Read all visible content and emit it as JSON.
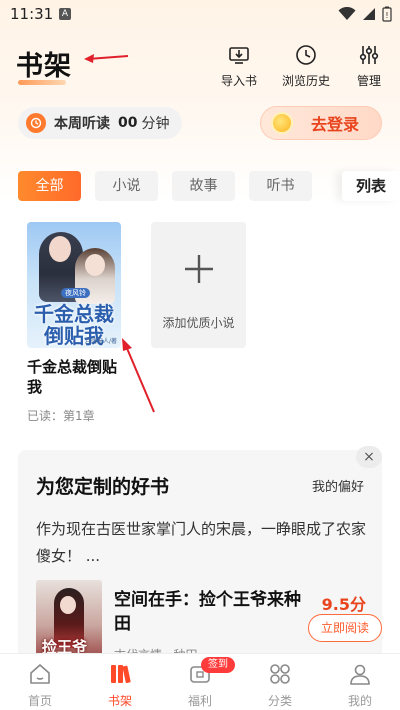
{
  "status_bar": {
    "time": "11:31",
    "notification": "A"
  },
  "header": {
    "title": "书架",
    "actions": [
      {
        "icon": "import-book-icon",
        "label": "导入书"
      },
      {
        "icon": "history-clock-icon",
        "label": "浏览历史"
      },
      {
        "icon": "manage-sliders-icon",
        "label": "管理"
      }
    ]
  },
  "listen": {
    "label": "本周听读",
    "value": "00",
    "unit": "分钟"
  },
  "login": {
    "label": "去登录"
  },
  "filter_tabs": [
    "全部",
    "小说",
    "故事",
    "听书"
  ],
  "list_toggle": "列表",
  "shelf": {
    "book": {
      "title": "千金总裁倒贴我",
      "progress": "已读：第1章",
      "cover": {
        "tag": "夜风铃",
        "title_line1": "千金总裁",
        "title_line2": "倒贴我",
        "author": "月落无人/著"
      }
    },
    "add_label": "添加优质小说"
  },
  "recommend": {
    "close": "×",
    "title": "为您定制的好书",
    "preference": "我的偏好",
    "description": "作为现在古医世家掌门人的宋晨，一睁眼成了农家傻女！ ...",
    "book": {
      "title": "空间在手：捡个王爷来种田",
      "score": "9.5分",
      "meta": "古代言情 · 种田",
      "read_button": "立即阅读",
      "cover_text": "捡王爷"
    }
  },
  "bottom_nav": {
    "items": [
      {
        "icon": "home-icon",
        "label": "首页"
      },
      {
        "icon": "bookshelf-icon",
        "label": "书架"
      },
      {
        "icon": "welfare-icon",
        "label": "福利"
      },
      {
        "icon": "category-icon",
        "label": "分类"
      },
      {
        "icon": "profile-icon",
        "label": "我的"
      }
    ],
    "badge": "签到",
    "active_index": 1
  },
  "colors": {
    "accent": "#ff6a2a",
    "login_text": "#e8451e",
    "annotation_arrow": "#e0202a"
  }
}
